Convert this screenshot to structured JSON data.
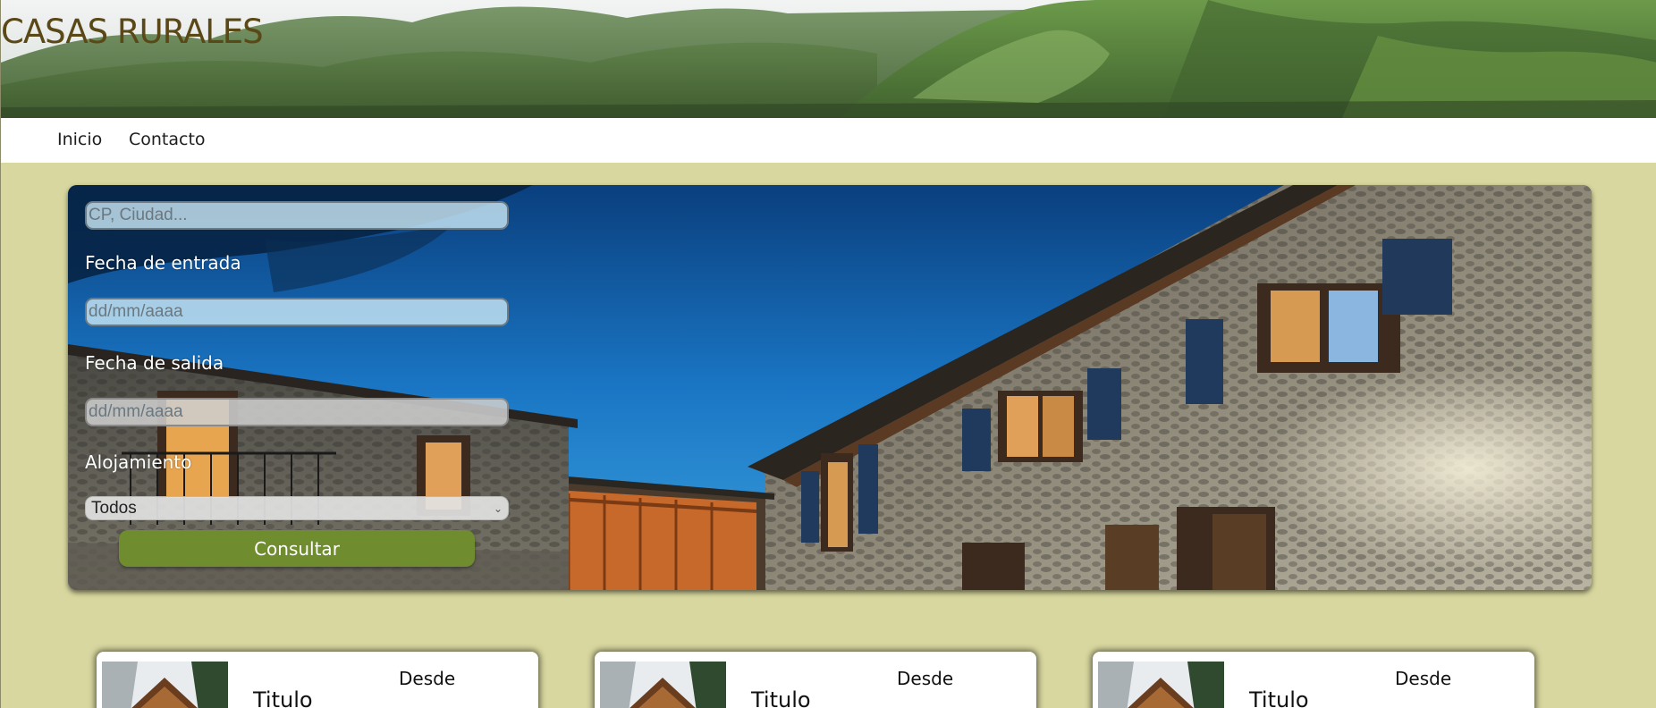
{
  "header": {
    "title": "CASAS RURALES"
  },
  "nav": {
    "items": [
      {
        "label": "Inicio"
      },
      {
        "label": "Contacto"
      }
    ]
  },
  "search": {
    "location_placeholder": "CP, Ciudad...",
    "checkin_label": "Fecha de entrada",
    "checkin_placeholder": "dd/mm/aaaa",
    "checkout_label": "Fecha de salida",
    "checkout_placeholder": "dd/mm/aaaa",
    "accommodation_label": "Alojamiento",
    "accommodation_selected": "Todos",
    "submit_label": "Consultar"
  },
  "cards": [
    {
      "title": "Titulo",
      "price_prefix": "Desde"
    },
    {
      "title": "Titulo",
      "price_prefix": "Desde"
    },
    {
      "title": "Titulo",
      "price_prefix": "Desde"
    }
  ],
  "colors": {
    "page_background": "#d8d79f",
    "title_color": "#5a4816",
    "button_green": "#6f8c2e",
    "nav_background": "#ffffff"
  },
  "icons": {
    "select_chevron": "chevron-down-icon"
  }
}
